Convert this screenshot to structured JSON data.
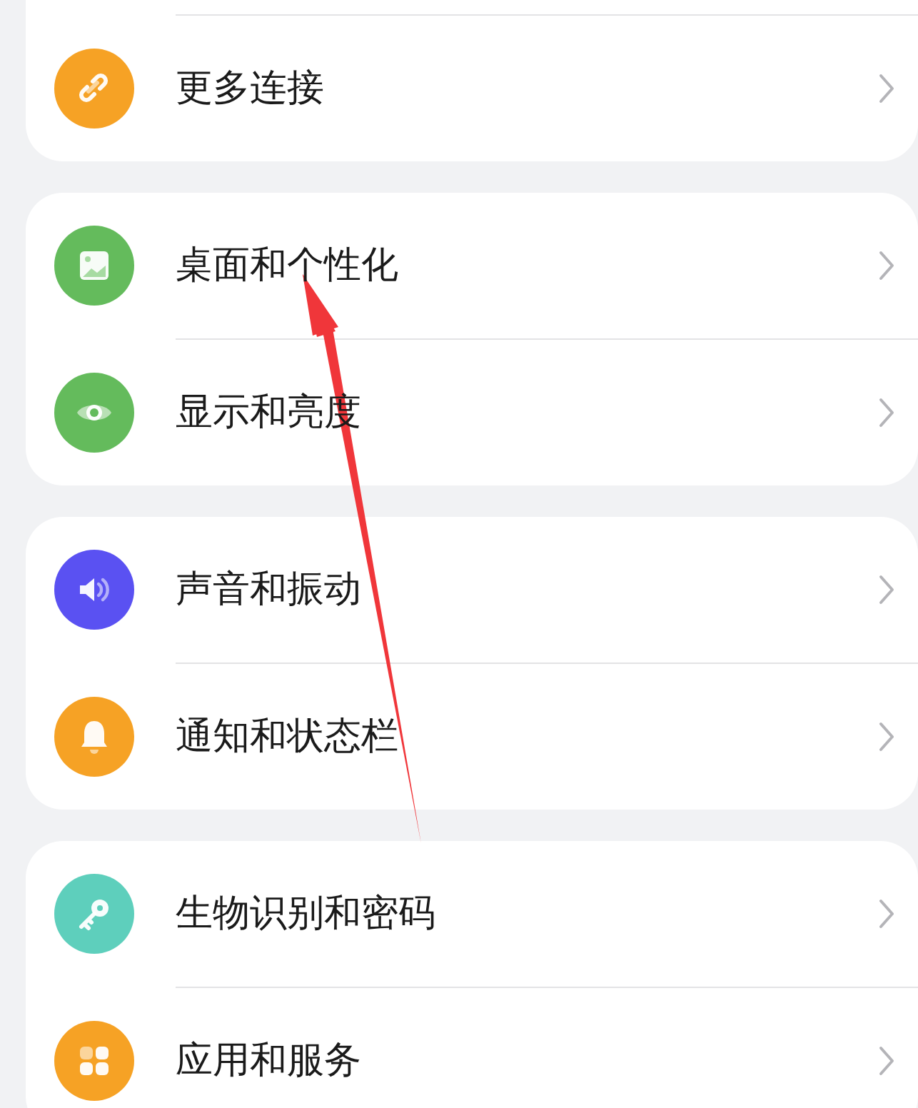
{
  "groups": [
    {
      "items": [
        {
          "label": "更多连接",
          "kind": "link",
          "color": "#f6a225"
        }
      ]
    },
    {
      "items": [
        {
          "label": "桌面和个性化",
          "kind": "image",
          "color": "#64bb5c"
        },
        {
          "label": "显示和亮度",
          "kind": "eye",
          "color": "#64bb5c"
        }
      ]
    },
    {
      "items": [
        {
          "label": "声音和振动",
          "kind": "speaker",
          "color": "#5a51f2"
        },
        {
          "label": "通知和状态栏",
          "kind": "bell",
          "color": "#f6a225"
        }
      ]
    },
    {
      "items": [
        {
          "label": "生物识别和密码",
          "kind": "key",
          "color": "#5ecfbc"
        },
        {
          "label": "应用和服务",
          "kind": "apps",
          "color": "#f6a225"
        }
      ]
    }
  ]
}
